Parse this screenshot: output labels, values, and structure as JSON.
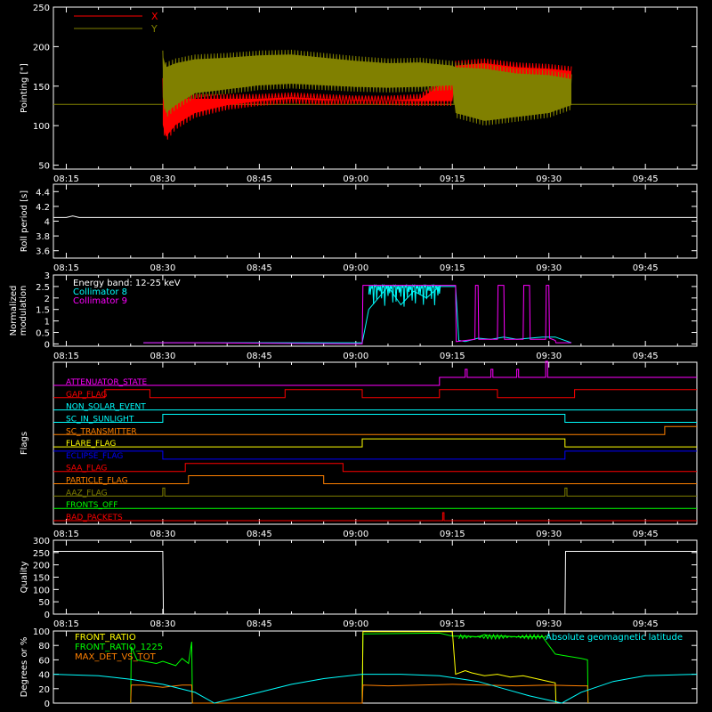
{
  "time_axis": {
    "tick_labels": [
      "08:15",
      "08:30",
      "08:45",
      "09:00",
      "09:15",
      "09:30",
      "09:45"
    ],
    "tick_minutes": [
      0,
      15,
      30,
      45,
      60,
      75,
      90
    ],
    "range_minutes": [
      -2,
      98
    ]
  },
  "colors": {
    "axes": "#ffffff",
    "x_series": "#ff0000",
    "y_series": "#808000",
    "reference_line": "#808000",
    "roll": "#ffffff",
    "collimator8": "#00ffff",
    "collimator9": "#ff00ff",
    "front_ratio": "#ffff00",
    "front_ratio_1225": "#00ff00",
    "max_det": "#ff8000",
    "geomag": "#00ffff",
    "quality": "#ffffff"
  },
  "chart_data": [
    {
      "id": "pointing",
      "type": "area",
      "ylabel": "Pointing [\"]",
      "ylim": [
        45,
        250
      ],
      "yticks": [
        50,
        100,
        150,
        200,
        250
      ],
      "legend": {
        "position": "top-left",
        "entries": [
          {
            "name": "X",
            "color": "#ff0000"
          },
          {
            "name": "Y",
            "color": "#808000"
          }
        ]
      },
      "reference_line": 127,
      "active_minutes": [
        15,
        78.5
      ],
      "series": [
        {
          "name": "X",
          "color": "#ff0000",
          "x": [
            15,
            15.5,
            17,
            20,
            25,
            30,
            35,
            40,
            45,
            50,
            55,
            60,
            60.5,
            65,
            70,
            75,
            78.5
          ],
          "low": [
            95,
            80,
            95,
            110,
            120,
            125,
            128,
            126,
            127,
            126,
            125,
            125,
            155,
            160,
            158,
            150,
            150
          ],
          "high": [
            160,
            150,
            140,
            140,
            140,
            140,
            142,
            140,
            138,
            138,
            140,
            168,
            182,
            185,
            180,
            178,
            175
          ]
        },
        {
          "name": "Y",
          "color": "#808000",
          "x": [
            15,
            15.5,
            17,
            20,
            25,
            30,
            35,
            40,
            45,
            50,
            55,
            60,
            60.5,
            65,
            70,
            75,
            78.5
          ],
          "low": [
            130,
            110,
            120,
            135,
            140,
            145,
            147,
            145,
            143,
            142,
            143,
            145,
            110,
            100,
            105,
            110,
            120
          ],
          "high": [
            195,
            180,
            185,
            190,
            192,
            195,
            196,
            192,
            188,
            185,
            186,
            182,
            180,
            178,
            172,
            170,
            165
          ]
        }
      ]
    },
    {
      "id": "roll",
      "type": "line",
      "ylabel": "Roll period [s]",
      "ylim": [
        3.5,
        4.5
      ],
      "yticks": [
        3.6,
        3.8,
        4.0,
        4.2,
        4.4
      ],
      "series": [
        {
          "name": "",
          "color": "#ffffff",
          "x": [
            -2,
            0,
            1,
            2,
            98
          ],
          "y": [
            4.05,
            4.05,
            4.07,
            4.05,
            4.05
          ]
        }
      ]
    },
    {
      "id": "modulation",
      "type": "line",
      "ylabel": "Normalized modulation",
      "ylim": [
        -0.1,
        3.0
      ],
      "yticks": [
        0.0,
        0.5,
        1.0,
        1.5,
        2.0,
        2.5,
        3.0
      ],
      "legend": {
        "position": "top-left",
        "entries": [
          {
            "name": "Energy band: 12-25 keV",
            "color": "#ffffff"
          },
          {
            "name": "Collimator 8",
            "color": "#00ffff"
          },
          {
            "name": "Collimator 9",
            "color": "#ff00ff"
          }
        ]
      },
      "series": [
        {
          "name": "Collimator 8",
          "color": "#00ffff",
          "x": [
            12,
            20,
            46,
            47,
            50,
            52,
            54,
            56,
            58,
            60.5,
            61,
            62,
            64,
            66,
            68,
            70,
            72,
            74,
            76,
            77,
            78.5
          ],
          "y": [
            0.05,
            0.05,
            0.05,
            1.5,
            2.5,
            1.7,
            2.3,
            2.0,
            2.5,
            2.5,
            0.15,
            0.1,
            0.25,
            0.2,
            0.3,
            0.2,
            0.25,
            0.3,
            0.3,
            0.2,
            0.05
          ]
        },
        {
          "name": "Collimator 9",
          "color": "#ff00ff",
          "x": [
            12,
            20,
            46,
            46.1,
            60.5,
            60.6,
            63.5,
            63.6,
            64,
            64.1,
            67,
            67.1,
            68,
            68.1,
            71,
            71.1,
            72,
            72.1,
            74.5,
            74.6,
            75,
            75.1,
            76,
            76.1,
            78.5
          ],
          "y": [
            0.05,
            0.05,
            0.0,
            2.55,
            2.55,
            0.1,
            0.2,
            2.55,
            2.55,
            0.2,
            0.2,
            2.55,
            2.55,
            0.2,
            0.2,
            2.55,
            2.55,
            0.2,
            0.2,
            2.55,
            2.55,
            0.25,
            0.15,
            0.05,
            0.05
          ]
        }
      ]
    },
    {
      "id": "flags",
      "type": "line",
      "ylabel": "Flags",
      "flags": [
        {
          "name": "ATTENUATOR_STATE",
          "color": "#ff00ff",
          "steps": [
            [
              -2,
              0
            ],
            [
              58,
              1
            ],
            [
              62,
              2
            ],
            [
              62.3,
              1
            ],
            [
              66,
              2
            ],
            [
              66.3,
              1
            ],
            [
              70,
              2
            ],
            [
              70.3,
              1
            ],
            [
              74.5,
              3
            ],
            [
              74.8,
              1
            ],
            [
              98,
              1
            ]
          ]
        },
        {
          "name": "GAP_FLAG",
          "color": "#ff0000",
          "steps": [
            [
              -2,
              0
            ],
            [
              6,
              1
            ],
            [
              13,
              0
            ],
            [
              34,
              1
            ],
            [
              46,
              0
            ],
            [
              58,
              1
            ],
            [
              67,
              0
            ],
            [
              79,
              1
            ],
            [
              98,
              1
            ]
          ]
        },
        {
          "name": "NON_SOLAR_EVENT",
          "color": "#00ffff",
          "steps": [
            [
              -2,
              0
            ],
            [
              98,
              0
            ]
          ]
        },
        {
          "name": "SC_IN_SUNLIGHT",
          "color": "#00ffff",
          "steps": [
            [
              -2,
              0
            ],
            [
              15,
              1
            ],
            [
              77.5,
              0
            ],
            [
              98,
              0
            ]
          ]
        },
        {
          "name": "SC_TRANSMITTER",
          "color": "#ff8000",
          "steps": [
            [
              -2,
              0
            ],
            [
              93,
              1
            ],
            [
              98,
              1
            ]
          ]
        },
        {
          "name": "FLARE_FLAG",
          "color": "#ffff00",
          "steps": [
            [
              -2,
              0
            ],
            [
              46,
              1
            ],
            [
              77.5,
              0
            ],
            [
              98,
              0
            ]
          ]
        },
        {
          "name": "ECLIPSE_FLAG",
          "color": "#0000ff",
          "steps": [
            [
              -2,
              1
            ],
            [
              15,
              0
            ],
            [
              77.5,
              1
            ],
            [
              98,
              1
            ]
          ]
        },
        {
          "name": "SAA_FLAG",
          "color": "#ff0000",
          "steps": [
            [
              -2,
              0
            ],
            [
              18.5,
              1
            ],
            [
              43,
              0
            ],
            [
              98,
              0
            ]
          ]
        },
        {
          "name": "PARTICLE_FLAG",
          "color": "#ff8000",
          "steps": [
            [
              -2,
              0
            ],
            [
              19,
              1
            ],
            [
              40,
              0
            ],
            [
              98,
              0
            ]
          ]
        },
        {
          "name": "AAZ_FLAG",
          "color": "#808000",
          "steps": [
            [
              -2,
              0
            ],
            [
              15,
              1
            ],
            [
              15.3,
              0
            ],
            [
              77.5,
              1
            ],
            [
              77.8,
              0
            ],
            [
              98,
              0
            ]
          ]
        },
        {
          "name": "FRONTS_OFF",
          "color": "#00ff00",
          "steps": [
            [
              -2,
              0
            ],
            [
              98,
              0
            ]
          ]
        },
        {
          "name": "BAD_PACKETS",
          "color": "#ff0000",
          "steps": [
            [
              -2,
              0
            ],
            [
              58.5,
              1
            ],
            [
              58.7,
              0
            ],
            [
              98,
              0
            ]
          ]
        }
      ]
    },
    {
      "id": "quality",
      "type": "line",
      "ylabel": "Quality",
      "ylim": [
        0,
        300
      ],
      "yticks": [
        0,
        50,
        100,
        150,
        200,
        250,
        300
      ],
      "series": [
        {
          "name": "",
          "color": "#ffffff",
          "x": [
            -2,
            15,
            15.1,
            77.5,
            77.6,
            98
          ],
          "y": [
            255,
            255,
            0,
            0,
            255,
            255
          ]
        }
      ]
    },
    {
      "id": "ratios",
      "type": "line",
      "ylabel": "Degrees or %",
      "ylim": [
        0,
        100
      ],
      "yticks": [
        0,
        20,
        40,
        60,
        80,
        100
      ],
      "legend": {
        "position": "top-left",
        "entries": [
          {
            "name": "FRONT_RATIO",
            "color": "#ffff00"
          },
          {
            "name": "FRONT_RATIO_1225",
            "color": "#00ff00"
          },
          {
            "name": "MAX_DET_VS_TOT",
            "color": "#ff8000"
          }
        ]
      },
      "annotation": {
        "text": "Absolute geomagnetic latitude",
        "color": "#00ffff",
        "position": "top-right"
      },
      "series": [
        {
          "name": "FRONT_RATIO_1225",
          "color": "#00ff00",
          "x": [
            10,
            10.1,
            11,
            14,
            15,
            17,
            18,
            19,
            19.5,
            19.6,
            46,
            46.1,
            58,
            59,
            60,
            62,
            64,
            65,
            66,
            68,
            70,
            72,
            74,
            76,
            78,
            80,
            81,
            81.1
          ],
          "y": [
            0,
            78,
            60,
            55,
            58,
            52,
            62,
            55,
            85,
            0,
            0,
            96,
            97,
            95,
            93,
            93,
            92,
            95,
            93,
            93,
            92,
            92,
            92,
            68,
            65,
            62,
            60,
            0
          ]
        },
        {
          "name": "FRONT_RATIO",
          "color": "#ffff00",
          "x": [
            46,
            46.1,
            60,
            60.5,
            62,
            63,
            65,
            67,
            69,
            71,
            73,
            75,
            76,
            76.1
          ],
          "y": [
            0,
            99,
            99,
            40,
            45,
            42,
            38,
            40,
            36,
            38,
            34,
            30,
            28,
            0
          ]
        },
        {
          "name": "MAX_DET_VS_TOT",
          "color": "#ff8000",
          "x": [
            10,
            10.1,
            12,
            15,
            18,
            19.5,
            19.6,
            46,
            46.1,
            50,
            55,
            60,
            65,
            70,
            75,
            80,
            81,
            81.1
          ],
          "y": [
            0,
            25,
            25,
            22,
            25,
            25,
            0,
            0,
            25,
            24,
            25,
            26,
            25,
            24,
            25,
            24,
            24,
            0
          ]
        },
        {
          "name": "Absolute geomagnetic latitude",
          "color": "#00ffff",
          "x": [
            -2,
            5,
            10,
            15,
            20,
            23,
            30,
            35,
            40,
            46,
            52,
            58,
            64,
            68,
            72,
            77,
            80,
            85,
            90,
            98
          ],
          "y": [
            40,
            38,
            33,
            26,
            15,
            0,
            15,
            26,
            34,
            40,
            40,
            38,
            30,
            20,
            10,
            0,
            15,
            30,
            38,
            40
          ]
        }
      ]
    }
  ]
}
